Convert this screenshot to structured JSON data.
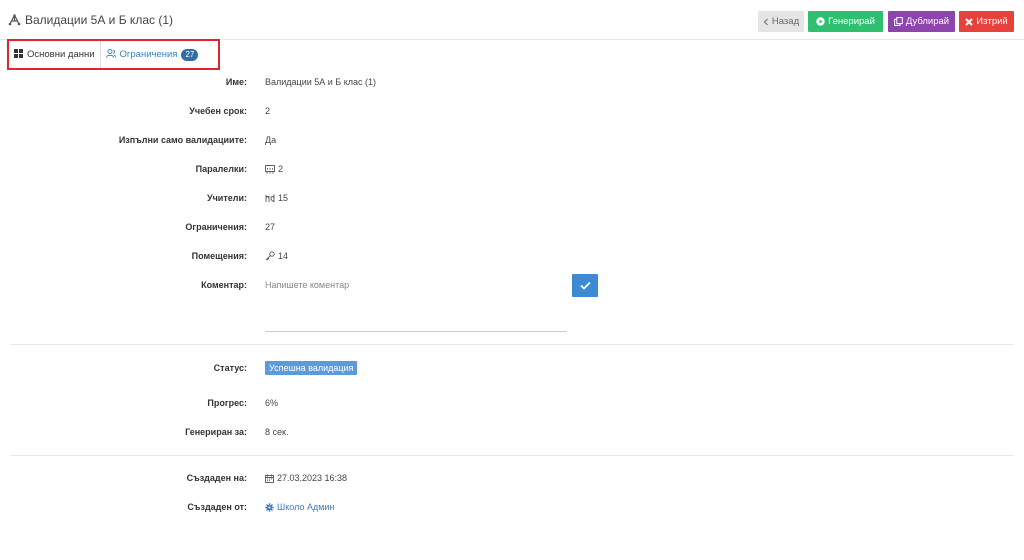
{
  "header": {
    "title": "Валидации 5А и Б клас (1)",
    "title_icon": "network-icon",
    "buttons": {
      "back": "Назад",
      "generate": "Генерирай",
      "duplicate": "Дублирай",
      "delete": "Изтрий"
    }
  },
  "tabs": {
    "main": "Основни данни",
    "constraints": "Ограничения",
    "constraints_count": "27"
  },
  "details": {
    "name": {
      "label": "Име:",
      "value": "Валидации 5А и Б клас (1)"
    },
    "term": {
      "label": "Учебен срок:",
      "value": "2"
    },
    "validations_only": {
      "label": "Изпълни само валидациите:",
      "value": "Да"
    },
    "classes": {
      "label": "Паралелки:",
      "value": "2"
    },
    "teachers": {
      "label": "Учители:",
      "value": "15"
    },
    "constraints": {
      "label": "Ограничения:",
      "value": "27"
    },
    "rooms": {
      "label": "Помещения:",
      "value": "14"
    },
    "comment": {
      "label": "Коментар:",
      "placeholder": "Напишете коментар",
      "value": ""
    }
  },
  "status": {
    "status": {
      "label": "Статус:",
      "value": "Успешна валидация"
    },
    "progress": {
      "label": "Прогрес:",
      "value": "6%"
    },
    "generated_in": {
      "label": "Генериран за:",
      "value": "8 сек."
    }
  },
  "meta": {
    "created_at": {
      "label": "Създаден на:",
      "value": "27.03.2023 16:38"
    },
    "created_by": {
      "label": "Създаден от:",
      "value": "Школо Админ"
    }
  },
  "colors": {
    "generate": "#2ec06f",
    "duplicate": "#8e44ad",
    "delete": "#e8413c",
    "primary": "#3d8ad4",
    "highlight_border": "#e0262a"
  }
}
